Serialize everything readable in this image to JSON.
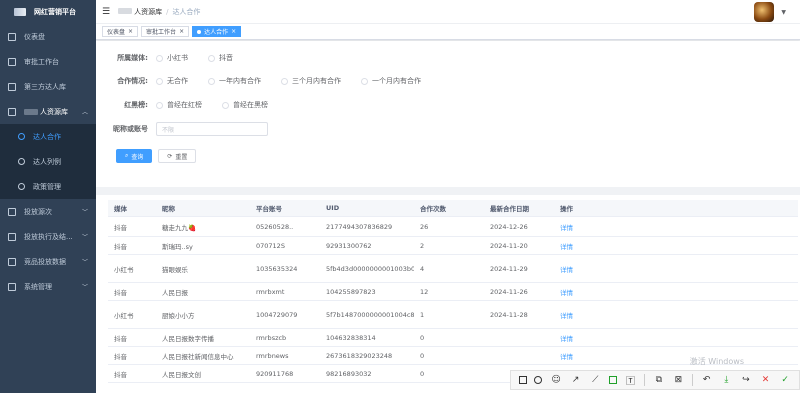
{
  "app": {
    "title": "网红营销平台"
  },
  "sidebar": {
    "items": [
      {
        "label": "仪表盘"
      },
      {
        "label": "审批工作台"
      },
      {
        "label": "第三方达人库"
      },
      {
        "label": "人资源库"
      }
    ],
    "subitems": [
      {
        "label": "达人合作"
      },
      {
        "label": "达人列例"
      },
      {
        "label": "政策管理"
      }
    ],
    "items_after": [
      {
        "label": "投放源次"
      },
      {
        "label": "投放执行及结..."
      },
      {
        "label": "竞品投放数据"
      },
      {
        "label": "系统管理"
      }
    ]
  },
  "header": {
    "breadcrumb": [
      "人资源库",
      "达人合作"
    ],
    "separator": "/"
  },
  "tabs": [
    {
      "label": "仪表盘",
      "close": "×"
    },
    {
      "label": "审批工作台",
      "close": "×"
    },
    {
      "label": "达人合作",
      "close": "×"
    }
  ],
  "filters": {
    "media": {
      "label": "所属媒体:",
      "options": [
        "小红书",
        "抖音"
      ]
    },
    "coop": {
      "label": "合作情况:",
      "options": [
        "无合作",
        "一年内有合作",
        "三个月内有合作",
        "一个月内有合作"
      ]
    },
    "blacklist": {
      "label": "红黑榜:",
      "options": [
        "曾经在红榜",
        "曾经在黑榜"
      ]
    },
    "nickname": {
      "label": "昵称或账号",
      "placeholder": "不限"
    },
    "search_button": "查询",
    "reset_button": "重置"
  },
  "table": {
    "headers": [
      "媒体",
      "昵称",
      "平台账号",
      "UID",
      "合作次数",
      "最新合作日期",
      "操作"
    ],
    "rows": [
      {
        "media": "抖音",
        "nick": "糖走九九🍓",
        "account": "05260528..",
        "uid": "2177494307836829",
        "count": "26",
        "date": "2024-12-26",
        "op": "详情"
      },
      {
        "media": "抖音",
        "nick": "斯瑞玛..sy",
        "account": "070712S",
        "uid": "92931300762",
        "count": "2",
        "date": "2024-11-20",
        "op": "详情"
      },
      {
        "media": "小红书",
        "nick": "猫眼娱乐",
        "account": "1035635324",
        "uid": "5fb4d3d0000000001003b04",
        "count": "4",
        "date": "2024-11-29",
        "op": "详情"
      },
      {
        "media": "抖音",
        "nick": "人民日报",
        "account": "rmrbxmt",
        "uid": "104255897823",
        "count": "12",
        "date": "2024-11-26",
        "op": "详情"
      },
      {
        "media": "小红书",
        "nick": "厨娘小小方",
        "account": "1004729079",
        "uid": "5f7b1487000000001004c8",
        "count": "1",
        "date": "2024-11-28",
        "op": "详情"
      },
      {
        "media": "抖音",
        "nick": "人民日报数字传播",
        "account": "rmrbszcb",
        "uid": "104632838314",
        "count": "0",
        "date": "",
        "op": "详情"
      },
      {
        "media": "抖音",
        "nick": "人民日报社新闻信息中心",
        "account": "rmrbnews",
        "uid": "2673618329023248",
        "count": "0",
        "date": "",
        "op": "详情"
      },
      {
        "media": "抖音",
        "nick": "人民日报文创",
        "account": "920911768",
        "uid": "98216893032",
        "count": "0",
        "date": "",
        "op": ""
      }
    ]
  },
  "watermark": "激活 Windows"
}
